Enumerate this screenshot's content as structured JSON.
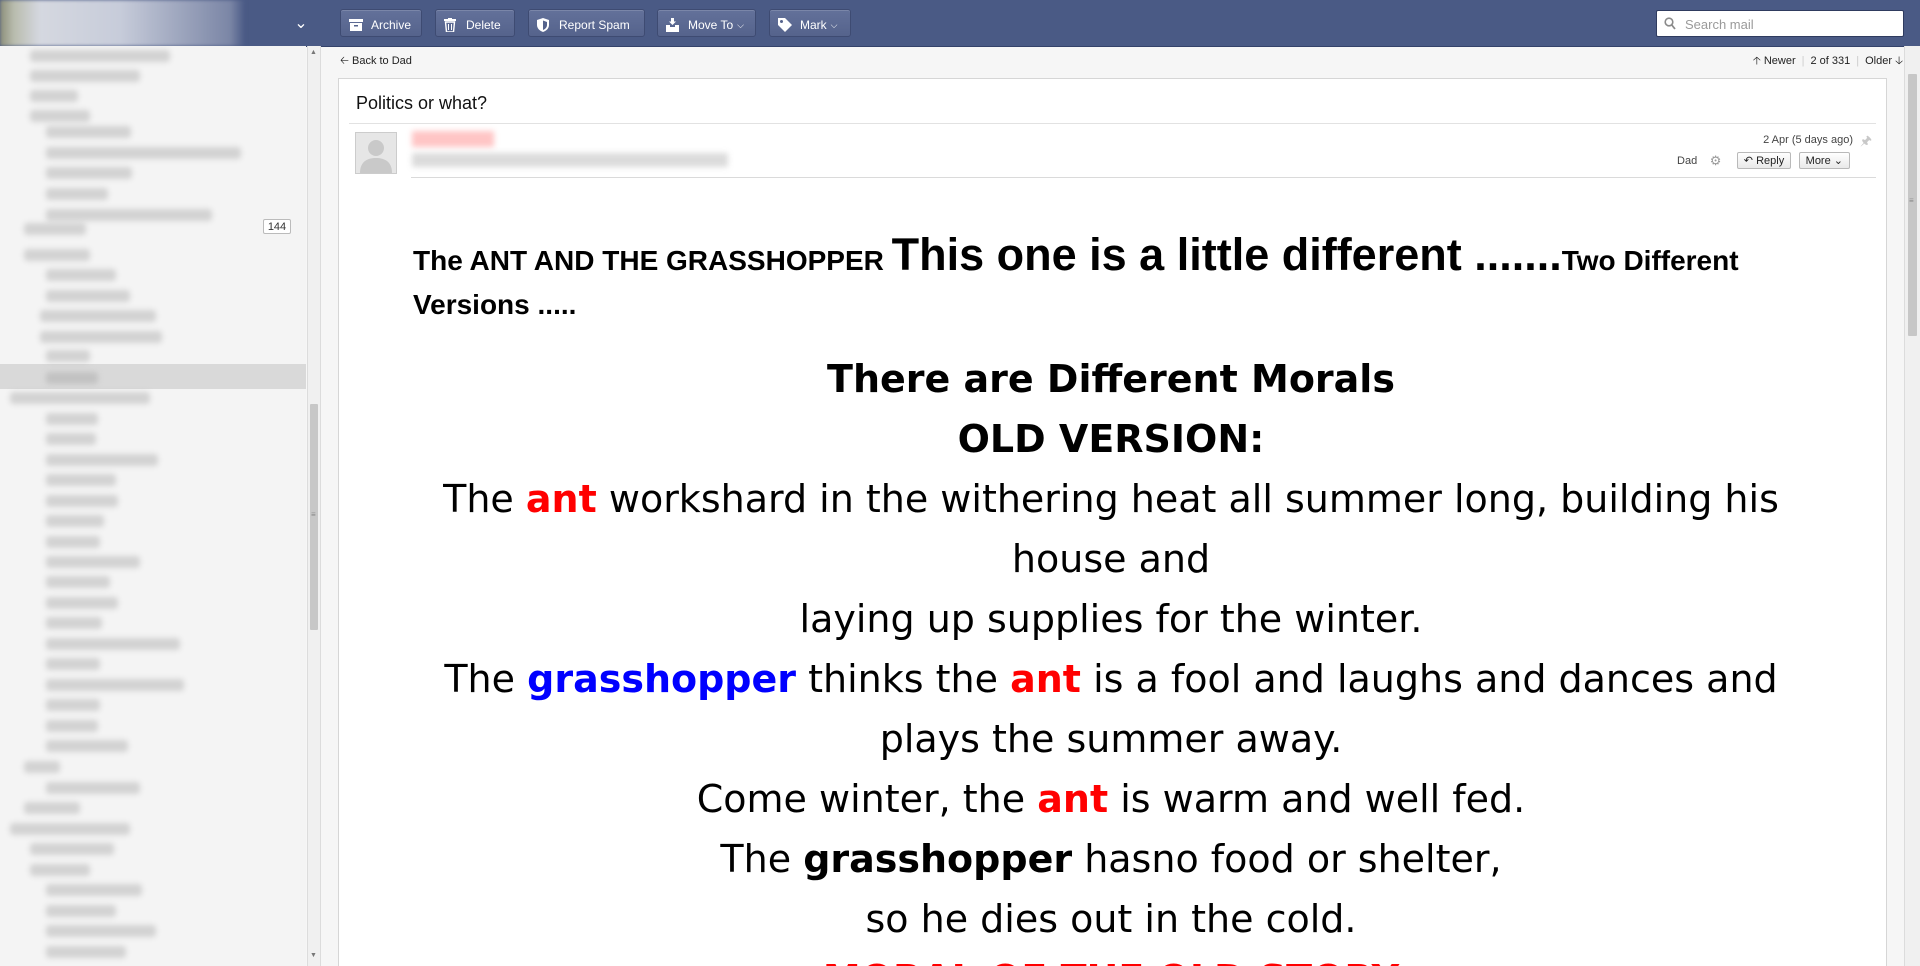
{
  "toolbar": {
    "archive": "Archive",
    "delete": "Delete",
    "spam": "Report Spam",
    "move": "Move To",
    "mark": "Mark"
  },
  "search": {
    "placeholder": "Search mail"
  },
  "sidebar": {
    "unread_count": "144"
  },
  "nav": {
    "back": "Back to Dad",
    "newer": "Newer",
    "position": "2 of 331",
    "older": "Older"
  },
  "message": {
    "subject": "Politics or what?",
    "date": "2 Apr (5 days ago)",
    "to_label": "Dad",
    "reply": "Reply",
    "more": "More",
    "intro_a": "The ANT AND THE GRASSHOPPER",
    "intro_big": "This one is a little different .......",
    "intro_b": "Two Different Versions .....",
    "heading1": "There are Different Morals",
    "heading2": "OLD VERSION:",
    "w_the": "The",
    "w_ant": "ant",
    "w_grasshopper": "grasshopper",
    "l1_rest": "workshard in the withering heat all summer long, building his house and",
    "l2": "laying up supplies for the winter.",
    "l3_mid": "thinks the",
    "l3_rest": "is a fool and laughs and dances and plays the summer away.",
    "l4_a": "Come winter, the",
    "l4_b": "is warm and well fed.",
    "l5_rest": "hasno food or shelter,",
    "l6": "so he dies out in the cold.",
    "moral": "MORAL OF THE OLD STORY"
  }
}
